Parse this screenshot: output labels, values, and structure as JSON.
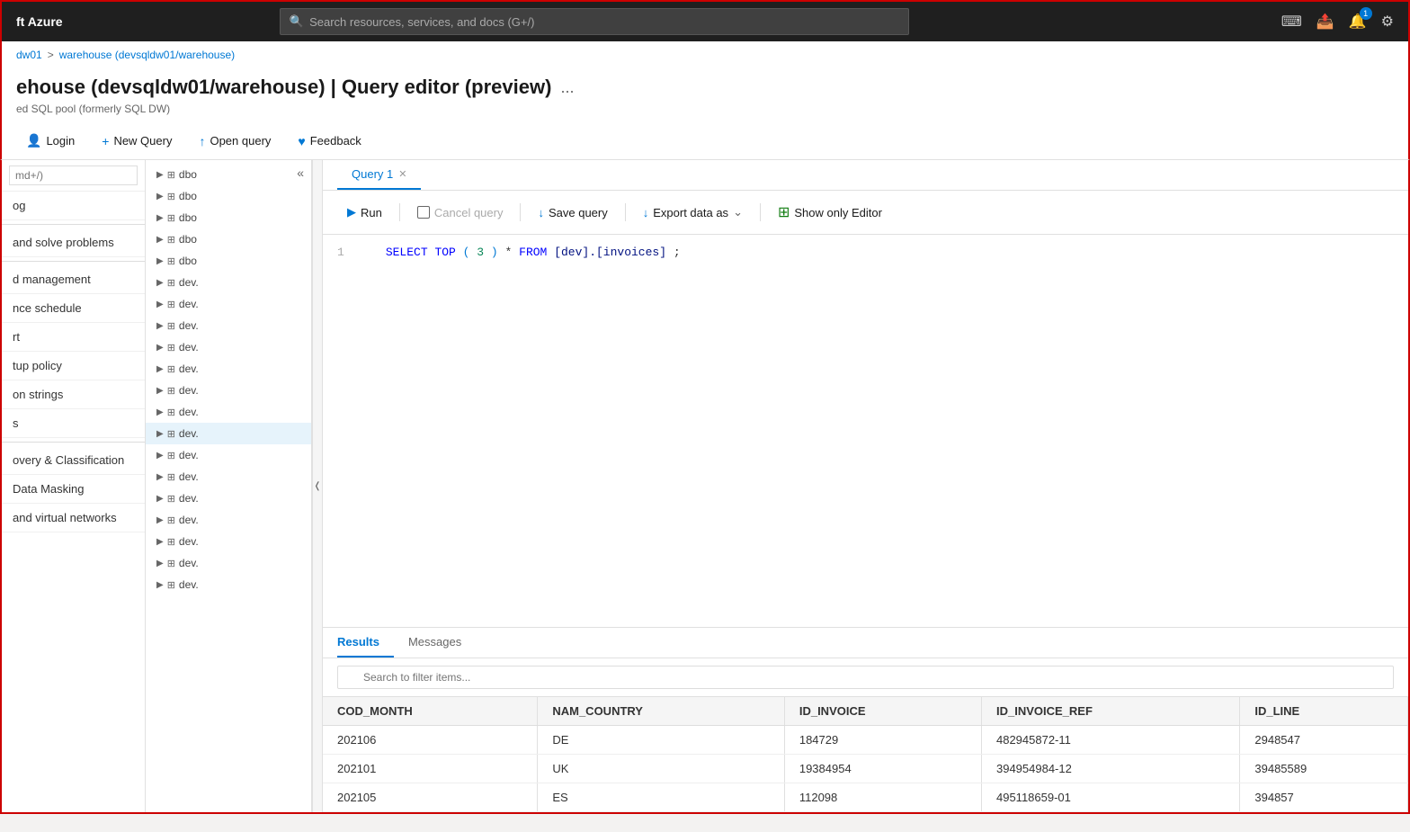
{
  "app": {
    "title": "ft Azure"
  },
  "topbar": {
    "search_placeholder": "Search resources, services, and docs (G+/)",
    "notification_count": "1"
  },
  "breadcrumb": {
    "part1": "dw01",
    "separator": ">",
    "part2": "warehouse (devsqldw01/warehouse)"
  },
  "page": {
    "title": "ehouse (devsqldw01/warehouse) | Query editor (preview)",
    "subtitle": "ed SQL pool (formerly SQL DW)",
    "more_label": "..."
  },
  "toolbar": {
    "login_label": "Login",
    "new_query_label": "New Query",
    "open_query_label": "Open query",
    "feedback_label": "Feedback"
  },
  "left_nav": {
    "items": [
      {
        "label": "og"
      },
      {
        "label": "and solve problems"
      },
      {
        "label": "d management"
      },
      {
        "label": "nce schedule"
      },
      {
        "label": "rt"
      },
      {
        "label": "tup policy"
      },
      {
        "label": "on strings"
      },
      {
        "label": "s"
      },
      {
        "label": "overy & Classification"
      },
      {
        "label": "Data Masking"
      },
      {
        "label": "and virtual networks"
      }
    ],
    "search_placeholder": "md+/)"
  },
  "sidebar": {
    "items": [
      {
        "label": "dbo",
        "type": "table"
      },
      {
        "label": "dbo",
        "type": "table"
      },
      {
        "label": "dbo",
        "type": "table"
      },
      {
        "label": "dbo",
        "type": "table"
      },
      {
        "label": "dbo",
        "type": "table"
      },
      {
        "label": "dev.",
        "type": "table"
      },
      {
        "label": "dev.",
        "type": "table"
      },
      {
        "label": "dev.",
        "type": "table"
      },
      {
        "label": "dev.",
        "type": "table"
      },
      {
        "label": "dev.",
        "type": "table"
      },
      {
        "label": "dev.",
        "type": "table"
      },
      {
        "label": "dev.",
        "type": "table"
      },
      {
        "label": "dev.",
        "type": "table",
        "active": true
      },
      {
        "label": "dev.",
        "type": "table"
      },
      {
        "label": "dev.",
        "type": "table"
      },
      {
        "label": "dev.",
        "type": "table"
      },
      {
        "label": "dev.",
        "type": "table"
      },
      {
        "label": "dev.",
        "type": "table"
      },
      {
        "label": "dev.",
        "type": "table"
      },
      {
        "label": "dev.",
        "type": "table"
      }
    ]
  },
  "query_editor": {
    "tab_label": "Query 1",
    "run_label": "Run",
    "cancel_label": "Cancel query",
    "save_label": "Save query",
    "export_label": "Export data as",
    "show_only_editor_label": "Show only Editor",
    "code_line": "SELECT TOP (3) * FROM [dev].[invoices];"
  },
  "results": {
    "tab_results": "Results",
    "tab_messages": "Messages",
    "search_placeholder": "Search to filter items...",
    "columns": [
      "COD_MONTH",
      "NAM_COUNTRY",
      "ID_INVOICE",
      "ID_INVOICE_REF",
      "ID_LINE"
    ],
    "rows": [
      [
        "202106",
        "DE",
        "184729",
        "482945872-11",
        "2948547"
      ],
      [
        "202101",
        "UK",
        "19384954",
        "394954984-12",
        "39485589"
      ],
      [
        "202105",
        "ES",
        "112098",
        "495118659-01",
        "394857"
      ]
    ]
  }
}
